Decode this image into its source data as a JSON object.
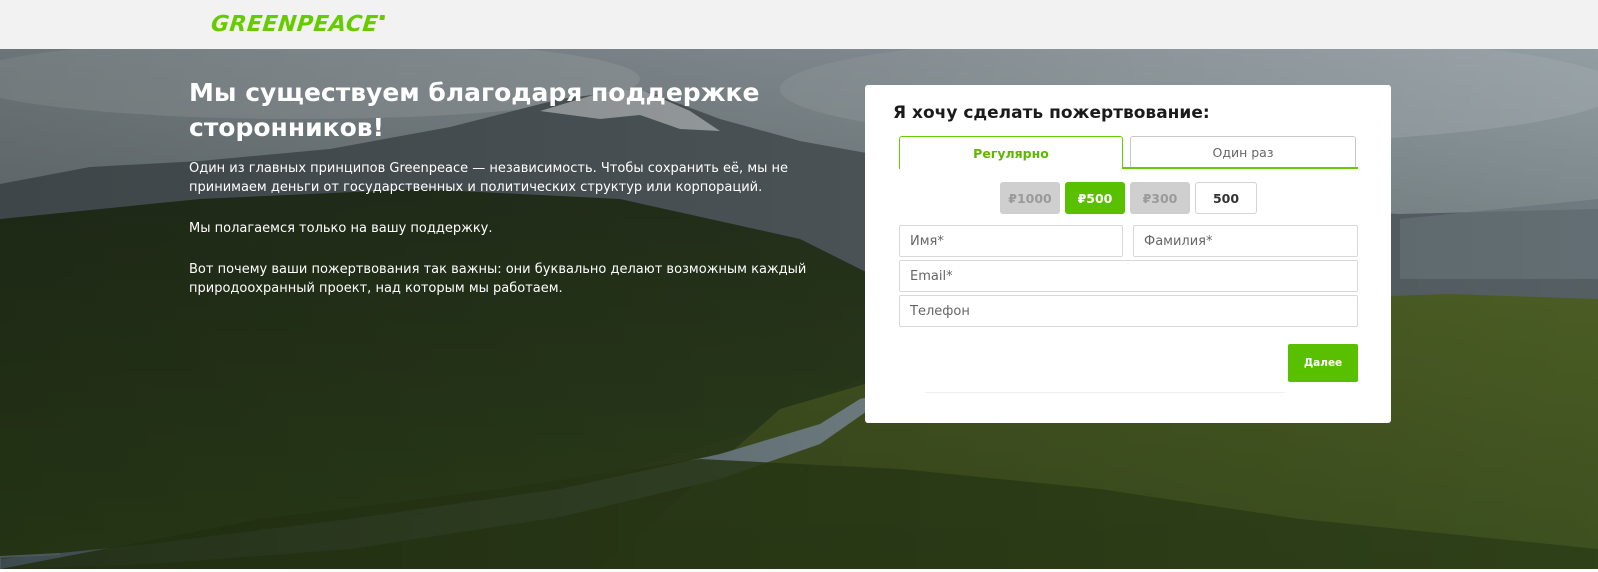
{
  "header": {
    "logo_text": "GREENPEACE",
    "brand_color": "#66cc00"
  },
  "hero": {
    "title": "Мы существуем благодаря поддержке сторонников!",
    "paragraph_1": "Один из главных принципов Greenpeace — независимость. Чтобы сохранить её, мы не принимаем деньги от государственных и политических структур или корпораций.",
    "paragraph_2": "Мы полагаемся только на вашу поддержку.",
    "paragraph_3": "Вот почему ваши пожертвования так важны: они буквально делают возможным каждый природоохранный проект, над которым мы работаем."
  },
  "donation_form": {
    "title": "Я хочу сделать пожертвование:",
    "tabs": [
      {
        "label": "Регулярно",
        "active": true
      },
      {
        "label": "Один раз",
        "active": false
      }
    ],
    "amounts": [
      {
        "label": "₽1000",
        "selected": false
      },
      {
        "label": "₽500",
        "selected": true
      },
      {
        "label": "₽300",
        "selected": false
      }
    ],
    "custom_amount_value": "500",
    "fields": {
      "first_name_placeholder": "Имя*",
      "last_name_placeholder": "Фамилия*",
      "email_placeholder": "Email*",
      "phone_placeholder": "Телефон"
    },
    "next_button_label": "Далее"
  },
  "colors": {
    "accent_green": "#59c000",
    "inactive_amount": "#cfcfcf"
  }
}
